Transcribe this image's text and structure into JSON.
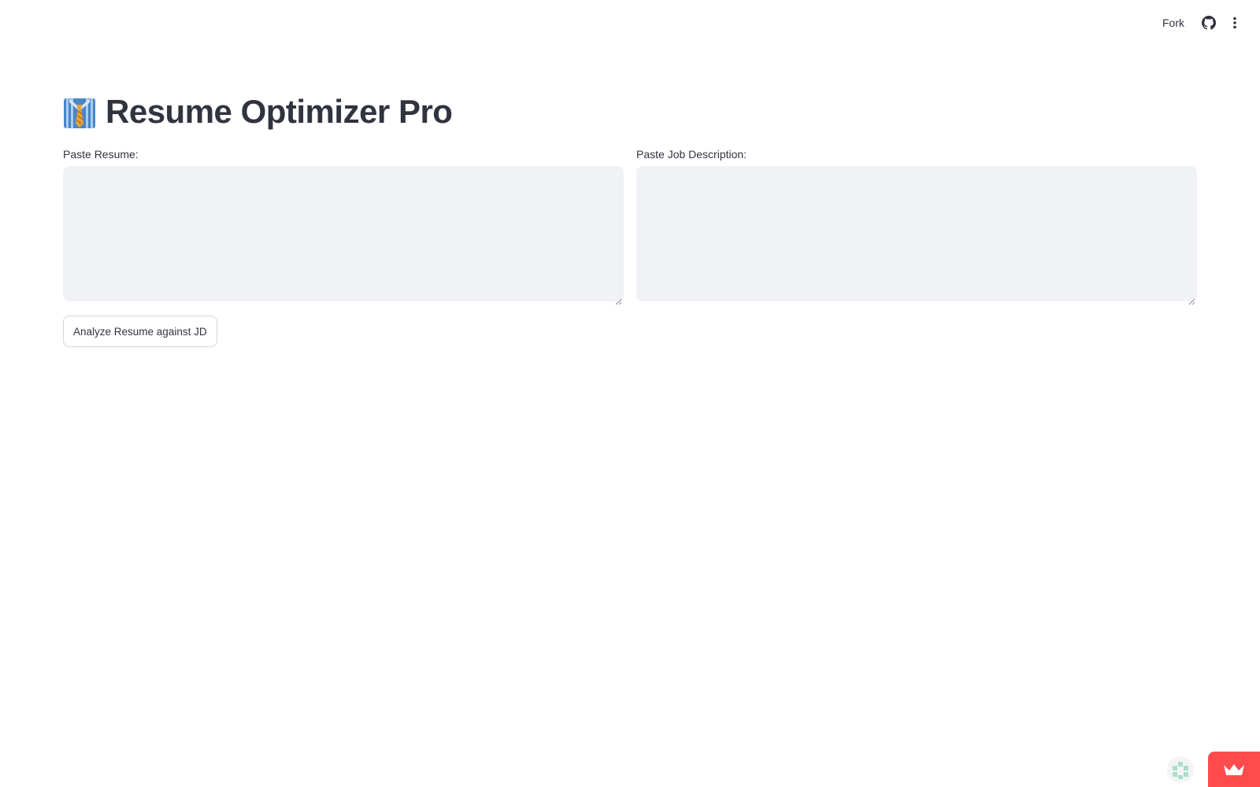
{
  "header": {
    "fork_label": "Fork",
    "github_icon": "github-icon",
    "menu_icon": "more-vertical-icon"
  },
  "main": {
    "title": "Resume Optimizer Pro",
    "title_icon": "necktie-shirt-icon",
    "resume_field": {
      "label": "Paste Resume:",
      "value": "",
      "placeholder": ""
    },
    "jd_field": {
      "label": "Paste Job Description:",
      "value": "",
      "placeholder": ""
    },
    "analyze_button_label": "Analyze Resume against JD"
  },
  "footer": {
    "status_icon": "app-status-icon",
    "badge_icon": "crown-icon"
  },
  "colors": {
    "accent": "#ff4b4b",
    "input_background": "#f0f2f6",
    "text": "#31333f"
  }
}
